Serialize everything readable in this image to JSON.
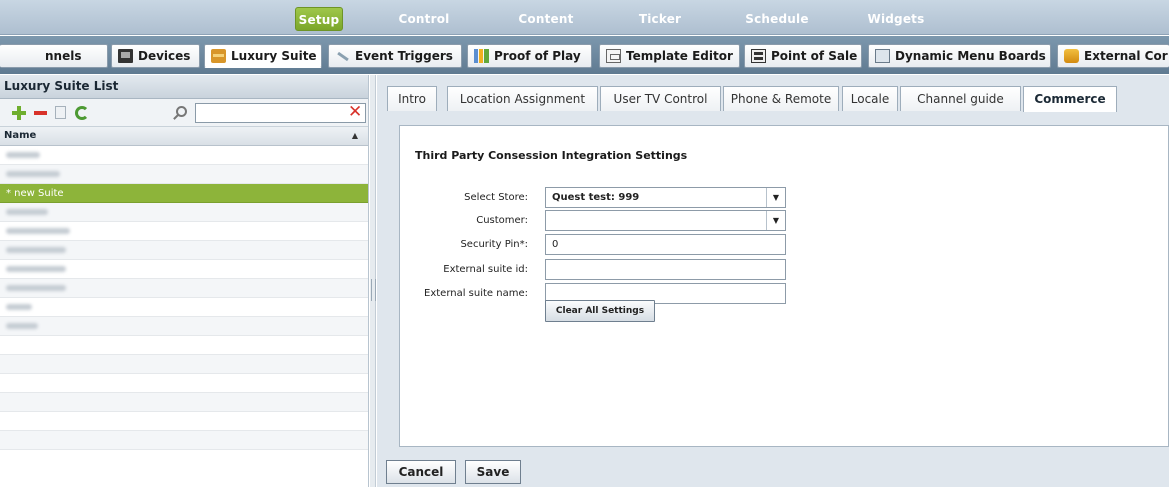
{
  "topnav": {
    "items": [
      {
        "label": "Setup",
        "active": true
      },
      {
        "label": "Control",
        "active": false
      },
      {
        "label": "Content",
        "active": false
      },
      {
        "label": "Ticker",
        "active": false
      },
      {
        "label": "Schedule",
        "active": false
      },
      {
        "label": "Widgets",
        "active": false
      }
    ]
  },
  "main_tabs": [
    {
      "label": "nnels",
      "icon": "channels-icon"
    },
    {
      "label": "Devices",
      "icon": "devices-icon"
    },
    {
      "label": "Luxury Suite",
      "icon": "luxury-suite-icon"
    },
    {
      "label": "Event Triggers",
      "icon": "event-triggers-icon"
    },
    {
      "label": "Proof of Play",
      "icon": "proof-of-play-icon"
    },
    {
      "label": "Template Editor",
      "icon": "template-editor-icon"
    },
    {
      "label": "Point of Sale",
      "icon": "point-of-sale-icon"
    },
    {
      "label": "Dynamic Menu Boards",
      "icon": "menu-boards-icon"
    },
    {
      "label": "External Cor",
      "icon": "external-content-icon"
    }
  ],
  "left_panel": {
    "title": "Luxury Suite List",
    "search": {
      "value": "",
      "placeholder": ""
    },
    "column_name": "Name",
    "rows": [
      {
        "label": "",
        "selected": false
      },
      {
        "label": "",
        "selected": false
      },
      {
        "label": "* new Suite",
        "selected": true
      },
      {
        "label": "",
        "selected": false
      },
      {
        "label": "",
        "selected": false
      },
      {
        "label": "",
        "selected": false
      },
      {
        "label": "",
        "selected": false
      },
      {
        "label": "",
        "selected": false
      },
      {
        "label": "",
        "selected": false
      },
      {
        "label": "",
        "selected": false
      }
    ]
  },
  "subtabs": [
    {
      "label": "Intro"
    },
    {
      "label": "Location Assignment"
    },
    {
      "label": "User TV Control"
    },
    {
      "label": "Phone & Remote"
    },
    {
      "label": "Locale"
    },
    {
      "label": "Channel guide"
    },
    {
      "label": "Commerce"
    }
  ],
  "active_subtab": "Commerce",
  "form": {
    "title": "Third Party Consession Integration Settings",
    "select_store_label": "Select Store:",
    "select_store_value": "Quest test: 999",
    "customer_label": "Customer:",
    "customer_value": "",
    "security_pin_label": "Security Pin*:",
    "security_pin_value": "0",
    "ext_suite_id_label": "External suite id:",
    "ext_suite_id_value": "",
    "ext_suite_name_label": "External suite name:",
    "ext_suite_name_value": "",
    "clear_button": "Clear All Settings"
  },
  "buttons": {
    "cancel": "Cancel",
    "save": "Save"
  },
  "colors": {
    "accent_green": "#8db43a",
    "danger_red": "#d8322a"
  }
}
